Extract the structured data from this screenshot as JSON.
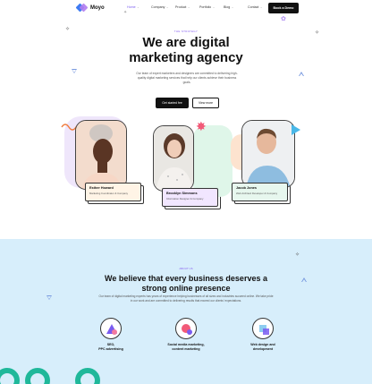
{
  "brand": {
    "name": "Moyo"
  },
  "nav": {
    "items": [
      {
        "label": "Home",
        "active": true
      },
      {
        "label": "Company"
      },
      {
        "label": "Product"
      },
      {
        "label": "Portfolio"
      },
      {
        "label": "Blog"
      },
      {
        "label": "Contact"
      }
    ],
    "cta_label": "Book a Demo"
  },
  "hero": {
    "eyebrow": "THE STRATEGY",
    "title_line1": "We are digital",
    "title_line2": "marketing agency",
    "subtitle": "Our team of expert marketers and designers are committed to delivering high-quality digital marketing services that help our clients achieve their business goals.",
    "primary_button": "Get started fee",
    "secondary_button": "View more"
  },
  "team": [
    {
      "name": "Esther Howard",
      "role": "Marketing Coordinator & Company"
    },
    {
      "name": "Brooklyn Simmons",
      "role": "Information Designer & Company"
    },
    {
      "name": "Jacob Jones",
      "role": "Web Architect Developer & Company"
    }
  ],
  "about": {
    "eyebrow": "ABOUT US",
    "title_line1": "We believe that every business deserves a",
    "title_line2": "strong online presence",
    "subtitle": "Our team of digital marketing experts has years of experience helping businesses of all sizes and industries succeed online. We take pride in our work and are committed to delivering results that exceed our clients' expectations.",
    "features": [
      {
        "line1": "SEO,",
        "line2": "PPC advertising",
        "icon": "seo-icon"
      },
      {
        "line1": "Social media marketing,",
        "line2": "content marketing",
        "icon": "social-media-icon"
      },
      {
        "line1": "Web design and",
        "line2": "development",
        "icon": "web-design-icon"
      }
    ]
  },
  "colors": {
    "accent": "#8a63f0",
    "section_bg": "#d7eefb",
    "teal": "#1fb89a"
  }
}
